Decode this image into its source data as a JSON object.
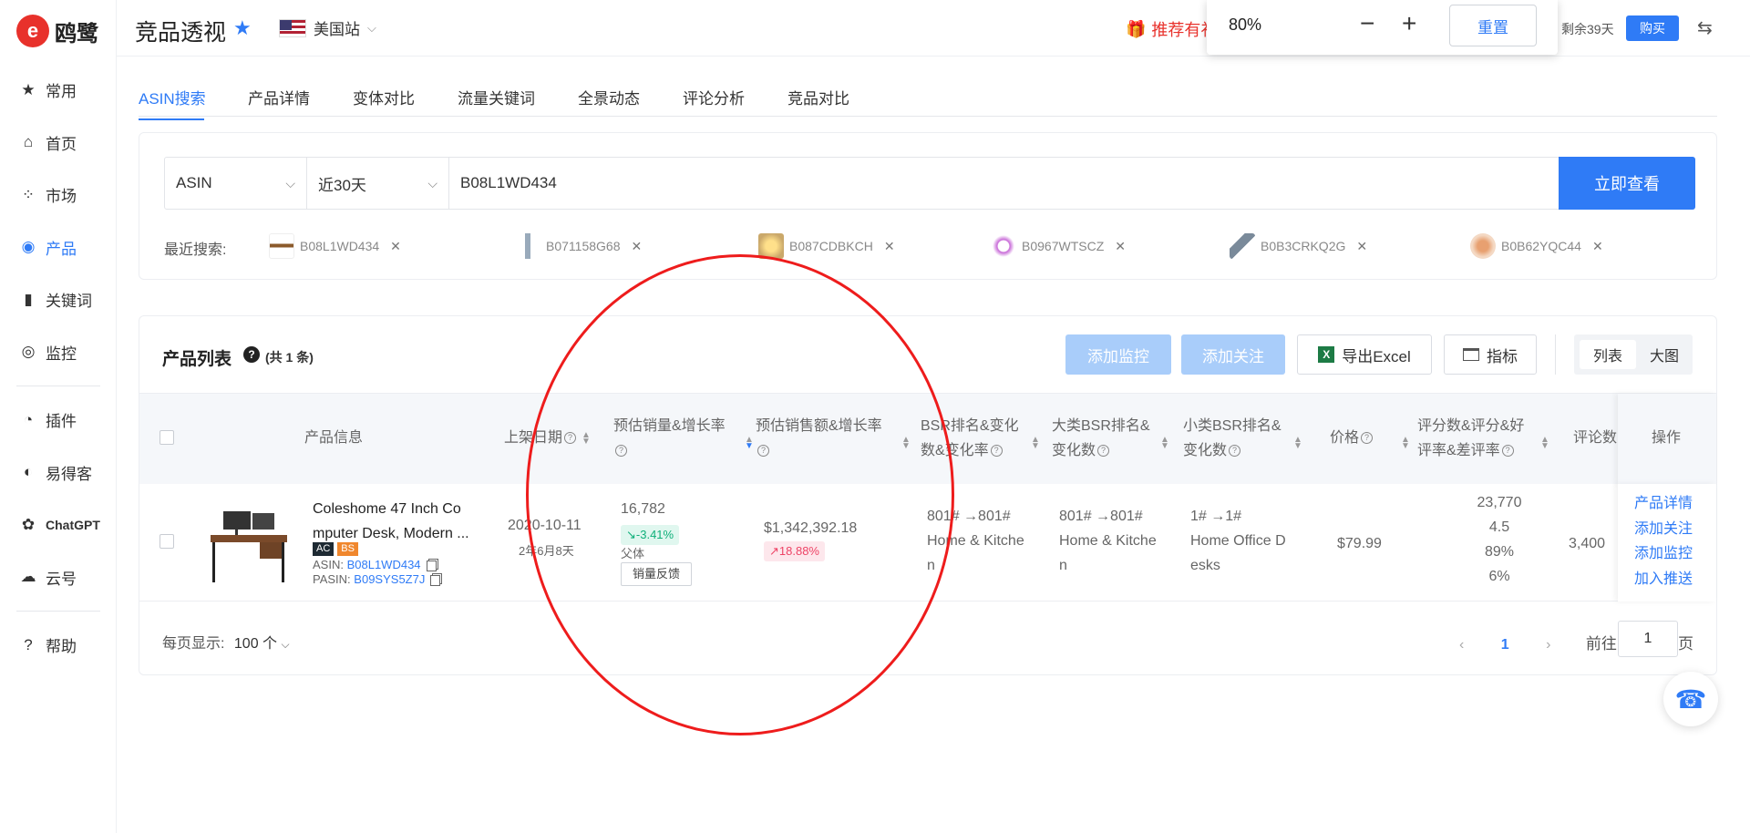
{
  "app": {
    "logo_text": "鸥鹭",
    "logo_mark": "e"
  },
  "sidebar": {
    "items": [
      {
        "label": "常用",
        "icon": "★"
      },
      {
        "label": "首页",
        "icon": "⌂"
      },
      {
        "label": "市场",
        "icon": "⁘"
      },
      {
        "label": "产品",
        "icon": "◉"
      },
      {
        "label": "关键词",
        "icon": "▮"
      },
      {
        "label": "监控",
        "icon": "◎"
      },
      {
        "label": "插件",
        "icon": "◔"
      },
      {
        "label": "易得客",
        "icon": "◐"
      },
      {
        "label": "ChatGPT",
        "icon": "✿"
      },
      {
        "label": "云号",
        "icon": "☁"
      },
      {
        "label": "帮助",
        "icon": "?"
      }
    ]
  },
  "header": {
    "title": "竞品透视",
    "site": "美国站",
    "recommend": "推荐有礼",
    "remain": "剩余39天",
    "buy": "购买"
  },
  "zoom": {
    "value": "80%",
    "minus": "−",
    "plus": "+",
    "reset": "重置"
  },
  "tabs": [
    "ASIN搜索",
    "产品详情",
    "变体对比",
    "流量关键词",
    "全景动态",
    "评论分析",
    "竞品对比"
  ],
  "search": {
    "type": "ASIN",
    "period": "近30天",
    "value": "B08L1WD434",
    "button": "立即查看",
    "recent_label": "最近搜索:",
    "recent": [
      "B08L1WD434",
      "B071158G68",
      "B087CDBKCH",
      "B0967WTSCZ",
      "B0B3CRKQ2G",
      "B0B62YQC44"
    ]
  },
  "list": {
    "title": "产品列表",
    "count": "(共 1 条)",
    "buttons": {
      "monitor": "添加监控",
      "follow": "添加关注",
      "export": "导出Excel",
      "metrics": "指标",
      "view_list": "列表",
      "view_grid": "大图"
    },
    "headers": {
      "product": "产品信息",
      "date": "上架日期",
      "sales_1": "预估销量&增长率",
      "revenue_1": "预估销售额&增长率",
      "bsr_1": "BSR排名&变化",
      "bsr_2": "数&变化率",
      "cat_1": "大类BSR排名&",
      "cat_2": "变化数",
      "sub_1": "小类BSR排名&",
      "sub_2": "变化数",
      "price": "价格",
      "rating_1": "评分数&评分&好",
      "rating_2": "评率&差评率",
      "reviews": "评论数",
      "ops": "操作"
    },
    "row": {
      "title_1": "Coleshome 47 Inch Co",
      "title_2": "mputer Desk, Modern ...",
      "tag_ac": "AC",
      "tag_bs": "BS",
      "asin_label": "ASIN:",
      "asin": "B08L1WD434",
      "pasin_label": "PASIN:",
      "pasin": "B09SYS5Z7J",
      "date": "2020-10-11",
      "age": "2年6月8天",
      "sales": "16,782",
      "sales_growth": "↘-3.41%",
      "parent": "父体",
      "feedback": "销量反馈",
      "revenue": "$1,342,392.18",
      "revenue_growth": "↗18.88%",
      "bsr_rank": "801# →801#",
      "bsr_cat_1": "Home & Kitche",
      "bsr_cat_2": "n",
      "cat_rank": "801# →801#",
      "cat_cat_1": "Home & Kitche",
      "cat_cat_2": "n",
      "sub_rank": "1# →1#",
      "sub_cat_1": "Home Office D",
      "sub_cat_2": "esks",
      "price": "$79.99",
      "rating_count": "23,770",
      "rating": "4.5",
      "good_rate": "89%",
      "bad_rate": "6%",
      "reviews": "3,400",
      "ops": [
        "产品详情",
        "添加关注",
        "添加监控",
        "加入推送"
      ]
    },
    "pagination": {
      "per_page_label": "每页显示:",
      "per_page": "100 个",
      "current": "1",
      "goto": "前往",
      "page_input": "1",
      "page_suffix": "页"
    }
  },
  "colors": {
    "accent": "#2f7bf6",
    "brand": "#e8312b",
    "annotation": "#ee1c1c"
  }
}
